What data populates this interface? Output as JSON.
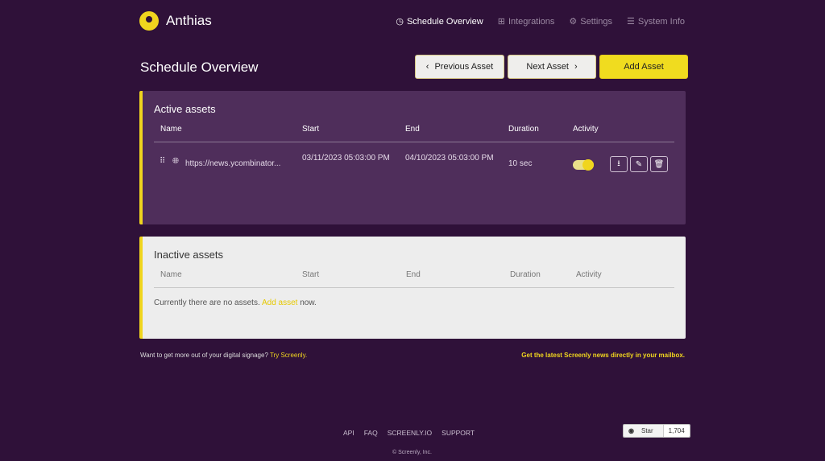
{
  "brand": {
    "name": "Anthias",
    "accent": "#f0d51e",
    "background": "#2f1139"
  },
  "nav": [
    {
      "label": "Schedule Overview",
      "icon": "clock-icon",
      "active": true
    },
    {
      "label": "Integrations",
      "icon": "plus-square-icon"
    },
    {
      "label": "Settings",
      "icon": "gear-icon"
    },
    {
      "label": "System Info",
      "icon": "list-icon"
    }
  ],
  "page": {
    "title": "Schedule Overview",
    "prev": "Previous Asset",
    "next": "Next Asset",
    "add": "Add Asset"
  },
  "active": {
    "title": "Active assets",
    "columns": [
      "Name",
      "Start",
      "End",
      "Duration",
      "Activity"
    ],
    "rows": [
      {
        "name": "https://news.ycombinator...",
        "start": "03/11/2023 05:03:00 PM",
        "end": "04/10/2023 05:03:00 PM",
        "duration": "10 sec",
        "enabled": true
      }
    ]
  },
  "inactive": {
    "title": "Inactive assets",
    "columns": [
      "Name",
      "Start",
      "End",
      "Duration",
      "Activity"
    ],
    "empty_pre": "Currently there are no assets.",
    "empty_link": "Add asset",
    "empty_post": "now."
  },
  "footer": {
    "promo": "Want to get more out of your digital signage?",
    "promo_link": "Try Screenly.",
    "news": "Get the latest Screenly news directly in your mailbox.",
    "links": [
      "API",
      "FAQ",
      "SCREENLY.IO",
      "SUPPORT"
    ],
    "copyright": "© Screenly, Inc.",
    "star": "Star",
    "stars": "1,704"
  }
}
